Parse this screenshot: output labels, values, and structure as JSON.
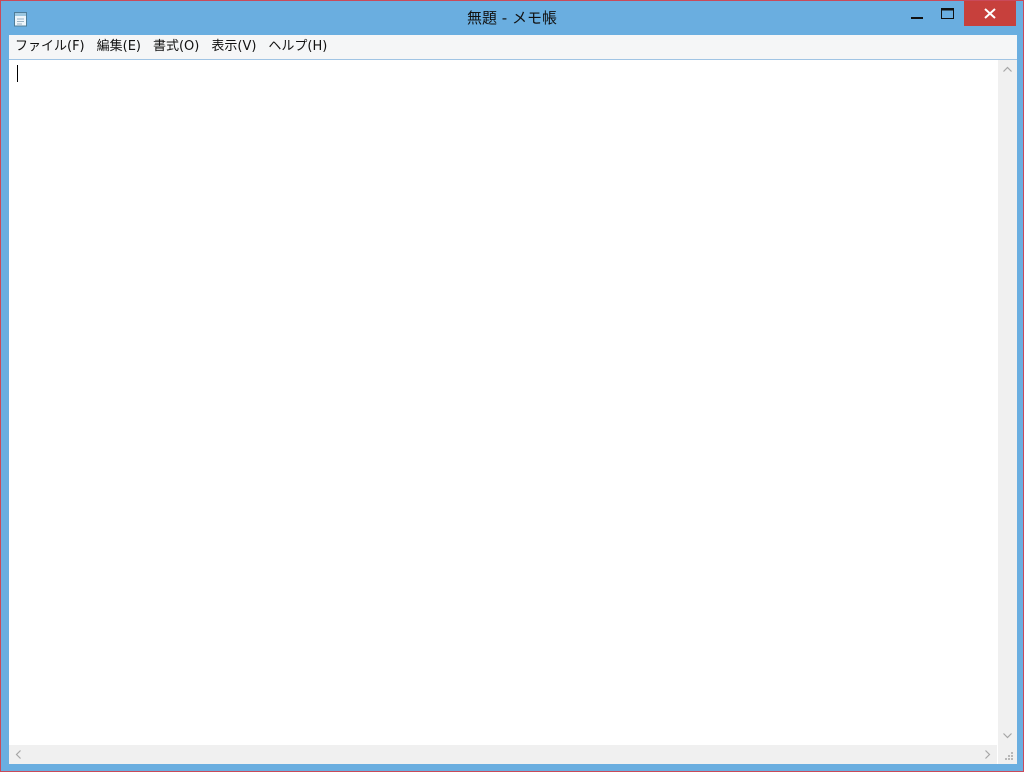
{
  "window": {
    "title": "無題 - メモ帳"
  },
  "menu": {
    "items": [
      {
        "label": "ファイル(F)"
      },
      {
        "label": "編集(E)"
      },
      {
        "label": "書式(O)"
      },
      {
        "label": "表示(V)"
      },
      {
        "label": "ヘルプ(H)"
      }
    ]
  },
  "editor": {
    "content": ""
  },
  "icons": {
    "app": "notepad-icon",
    "minimize": "minimize-icon",
    "maximize": "maximize-icon",
    "close": "close-icon"
  },
  "colors": {
    "titlebar": "#6aaee0",
    "close": "#c7403c",
    "border": "#c94a5a"
  }
}
